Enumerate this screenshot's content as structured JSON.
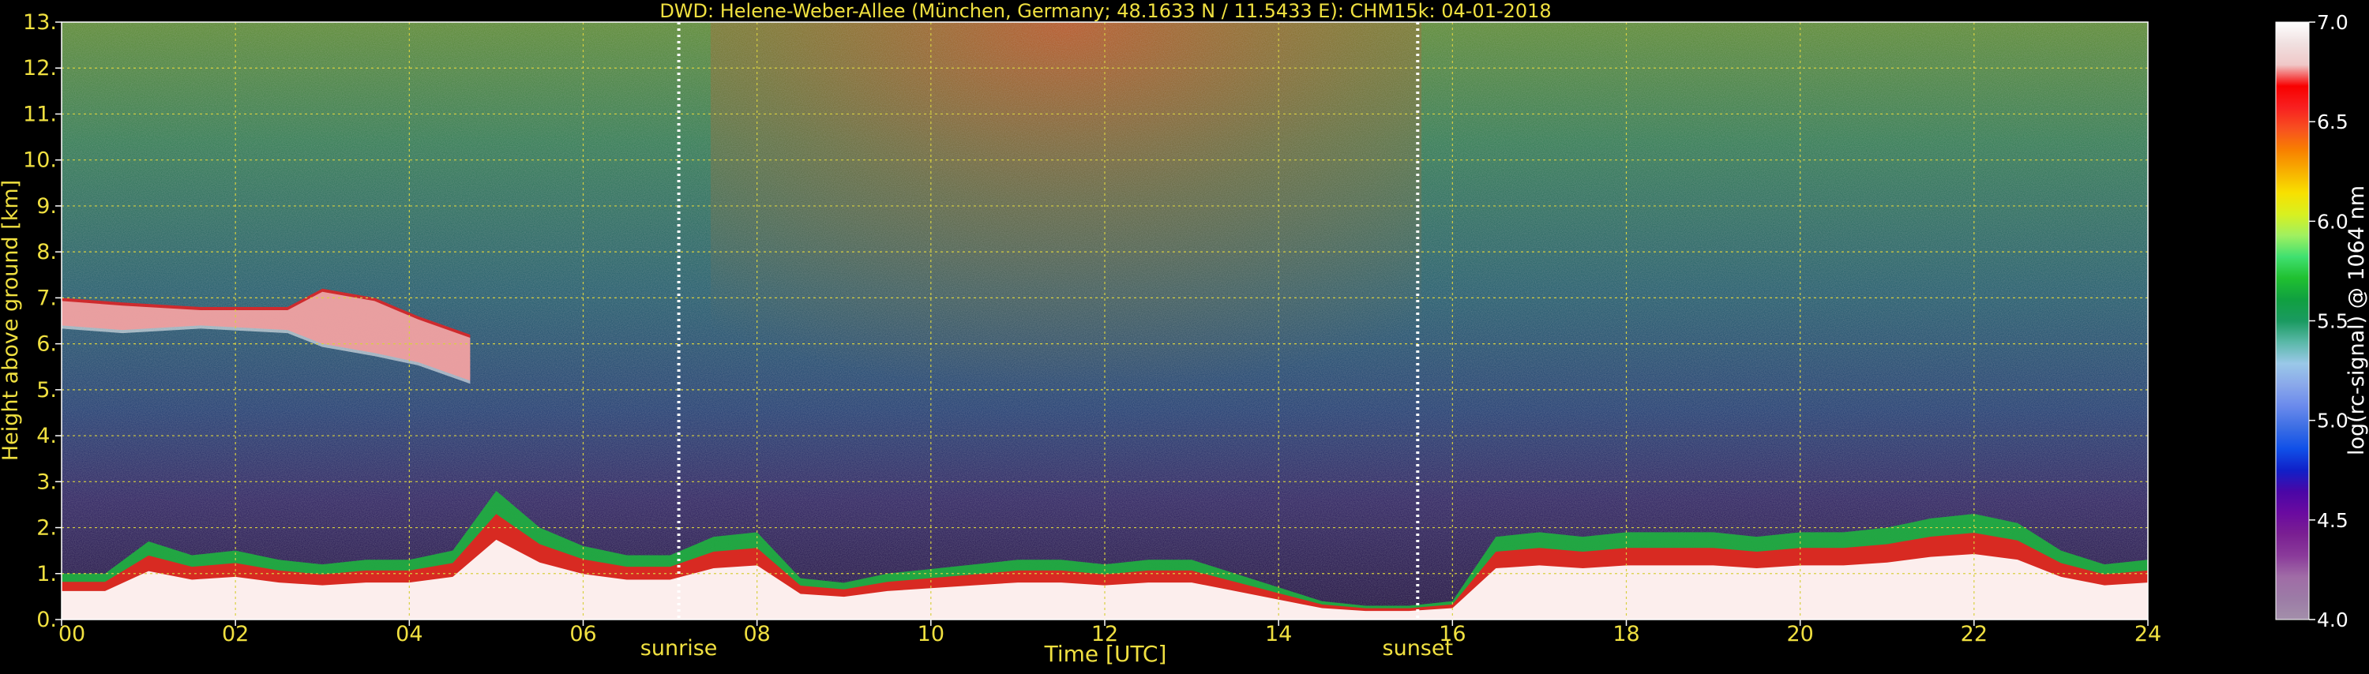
{
  "chart_data": {
    "type": "heatmap",
    "title": "DWD: Helene-Weber-Allee (München, Germany; 48.1633 N / 11.5433 E):    CHM15k: 04-01-2018",
    "xlabel": "Time [UTC]",
    "ylabel": "Height above ground [km]",
    "xlim": [
      0,
      24
    ],
    "ylim": [
      0,
      13
    ],
    "x_ticks": [
      "00",
      "02",
      "04",
      "06",
      "08",
      "10",
      "12",
      "14",
      "16",
      "18",
      "20",
      "22",
      "24"
    ],
    "y_ticks": [
      "0.",
      "1.",
      "2.",
      "3.",
      "4.",
      "5.",
      "6.",
      "7.",
      "8.",
      "9.",
      "10.",
      "11.",
      "12.",
      "13."
    ],
    "grid": true,
    "markers": [
      {
        "label": "sunrise",
        "x": 7.1
      },
      {
        "label": "sunset",
        "x": 15.6
      }
    ],
    "colorbar": {
      "label": "log(rc-signal) @ 1064 nm",
      "range": [
        4.0,
        7.0
      ],
      "ticks": [
        "4.0",
        "4.5",
        "5.0",
        "5.5",
        "6.0",
        "6.5",
        "7.0"
      ],
      "colors": [
        "#a38faa",
        "#9c7ba6",
        "#a06ca6",
        "#8a3a9a",
        "#7a1f92",
        "#6a0aa0",
        "#4a06a6",
        "#1020c8",
        "#1050e8",
        "#3c6ee4",
        "#6a8aec",
        "#8aa8ea",
        "#9ac8e8",
        "#5ab8a8",
        "#1a9a60",
        "#10a040",
        "#20c030",
        "#40e070",
        "#a0f060",
        "#d8f020",
        "#f8e000",
        "#f8b000",
        "#f88000",
        "#f85020",
        "#f82020",
        "#f80000",
        "#f0c8c8",
        "#f0e0e0",
        "#ffffff"
      ]
    },
    "layers": [
      {
        "name": "boundary-layer",
        "x": [
          0,
          0.5,
          1,
          1.5,
          2,
          2.5,
          3,
          3.5,
          4,
          4.5,
          5,
          5.5,
          6,
          6.5,
          7,
          7.5,
          8,
          8.5,
          9,
          9.5,
          10,
          10.5,
          11,
          11.5,
          12,
          12.5,
          13,
          13.5,
          14,
          14.5,
          15,
          15.5,
          16,
          16.5,
          17,
          17.5,
          18,
          18.5,
          19,
          19.5,
          20,
          20.5,
          21,
          21.5,
          22,
          22.5,
          23,
          23.5,
          24
        ],
        "top": [
          1.0,
          1.0,
          1.7,
          1.4,
          1.5,
          1.3,
          1.2,
          1.3,
          1.3,
          1.5,
          2.8,
          2.0,
          1.6,
          1.4,
          1.4,
          1.8,
          1.9,
          0.9,
          0.8,
          1.0,
          1.1,
          1.2,
          1.3,
          1.3,
          1.2,
          1.3,
          1.3,
          1.0,
          0.7,
          0.4,
          0.3,
          0.3,
          0.4,
          1.8,
          1.9,
          1.8,
          1.9,
          1.9,
          1.9,
          1.8,
          1.9,
          1.9,
          2.0,
          2.2,
          2.3,
          2.1,
          1.5,
          1.2,
          1.3
        ]
      },
      {
        "name": "mid-cloud",
        "x": [
          0.0,
          0.7,
          1.6,
          2.6,
          3.0,
          3.6,
          4.1,
          4.7
        ],
        "top": [
          7.0,
          6.9,
          6.8,
          6.8,
          7.2,
          7.0,
          6.6,
          6.2
        ],
        "bottom": [
          6.4,
          6.3,
          6.4,
          6.3,
          6.0,
          5.8,
          5.6,
          5.2
        ]
      }
    ]
  }
}
